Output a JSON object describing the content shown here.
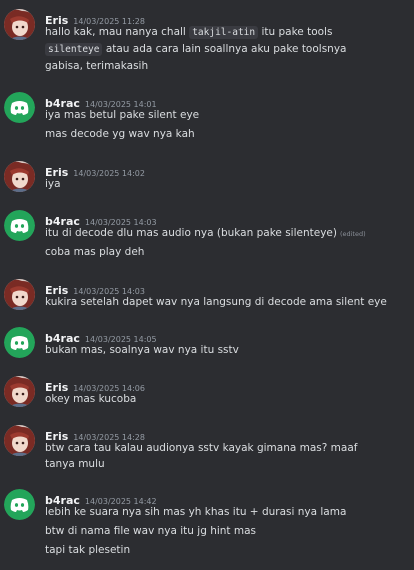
{
  "messages": [
    {
      "author": "Eris",
      "timestamp": "14/03/2025 11:28",
      "avatar_icon": "anime-avatar",
      "lines": [
        {
          "pre": "hallo kak, mau nanya chall ",
          "code": "takjil-atin",
          "post": " itu pake tools"
        },
        {
          "code": "silenteye",
          "post": " atau ada cara lain soallnya aku pake toolsnya"
        },
        {
          "text": "gabisa, terimakasih"
        }
      ]
    },
    {
      "author": "b4rac",
      "timestamp": "14/03/2025 14:01",
      "avatar_icon": "discord-logo-avatar",
      "lines": [
        {
          "text": "iya mas betul pake silent eye"
        },
        {
          "text": "mas decode yg wav nya kah"
        }
      ]
    },
    {
      "author": "Eris",
      "timestamp": "14/03/2025 14:02",
      "avatar_icon": "anime-avatar",
      "lines": [
        {
          "text": "iya"
        }
      ]
    },
    {
      "author": "b4rac",
      "timestamp": "14/03/2025 14:03",
      "avatar_icon": "discord-logo-avatar",
      "lines": [
        {
          "text": "itu di decode dlu mas audio nya (bukan pake silenteye)",
          "edited": "(edited)"
        },
        {
          "text": "coba mas play deh"
        }
      ]
    },
    {
      "author": "Eris",
      "timestamp": "14/03/2025 14:03",
      "avatar_icon": "anime-avatar",
      "lines": [
        {
          "text": "kukira setelah dapet wav nya langsung di decode ama silent eye"
        }
      ]
    },
    {
      "author": "b4rac",
      "timestamp": "14/03/2025 14:05",
      "avatar_icon": "discord-logo-avatar",
      "lines": [
        {
          "text": "bukan mas, soalnya wav nya itu sstv"
        }
      ]
    },
    {
      "author": "Eris",
      "timestamp": "14/03/2025 14:06",
      "avatar_icon": "anime-avatar",
      "lines": [
        {
          "text": "okey mas kucoba"
        }
      ]
    },
    {
      "author": "Eris",
      "timestamp": "14/03/2025 14:28",
      "avatar_icon": "anime-avatar",
      "lines": [
        {
          "text": "btw cara tau kalau audionya sstv kayak gimana mas? maaf"
        },
        {
          "text": "tanya mulu"
        }
      ]
    },
    {
      "author": "b4rac",
      "timestamp": "14/03/2025 14:42",
      "avatar_icon": "discord-logo-avatar",
      "lines": [
        {
          "text": "lebih ke suara nya sih mas yh khas itu + durasi nya lama"
        },
        {
          "text": "btw di nama file wav nya itu jg hint mas"
        },
        {
          "text": "tapi tak plesetin"
        }
      ]
    }
  ],
  "colors": {
    "background": "#2c2d31",
    "discord_green": "#23a55a",
    "username": "#f2f3f5",
    "timestamp": "#949ba4"
  }
}
